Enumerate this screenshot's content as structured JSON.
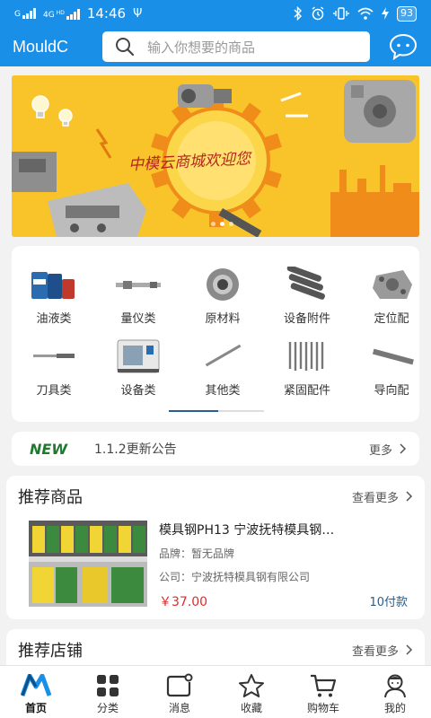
{
  "status_bar": {
    "carrier1": "G",
    "carrier2": "4G",
    "carrier2_sup": "HD",
    "time": "14:46",
    "usb": "Ψ",
    "battery": "93"
  },
  "header": {
    "logo": "MouldC",
    "search_placeholder": "输入你想要的商品",
    "accent_color": "#1a8fe8"
  },
  "banner": {
    "title": "中模云商城欢迎您",
    "dots": 3,
    "active_dot": 1
  },
  "categories": [
    {
      "label": "油液类",
      "icon": "oil-barrels-icon"
    },
    {
      "label": "量仪类",
      "icon": "gauge-instrument-icon"
    },
    {
      "label": "原材料",
      "icon": "raw-material-icon"
    },
    {
      "label": "设备附件",
      "icon": "equipment-accessory-icon"
    },
    {
      "label": "定位配",
      "icon": "positioning-part-icon"
    },
    {
      "label": "刀具类",
      "icon": "cutting-tool-icon"
    },
    {
      "label": "设备类",
      "icon": "machine-equipment-icon"
    },
    {
      "label": "其他类",
      "icon": "other-category-icon"
    },
    {
      "label": "紧固配件",
      "icon": "fastener-icon"
    },
    {
      "label": "导向配",
      "icon": "guide-part-icon"
    }
  ],
  "notice": {
    "badge": "NEW",
    "text": "1.1.2更新公告",
    "more": "更多"
  },
  "recommended": {
    "title": "推荐商品",
    "more": "查看更多",
    "product": {
      "name": "模具钢PH13 宁波抚特模具钢…",
      "brand": "品牌：暂无品牌",
      "company": "公司：宁波抚特模具钢有限公司",
      "price": "￥37.00",
      "payments": "10付款"
    }
  },
  "shops": {
    "title": "推荐店铺",
    "more": "查看更多"
  },
  "tabs": [
    {
      "label": "首页",
      "icon": "home-logo-icon",
      "active": true
    },
    {
      "label": "分类",
      "icon": "category-grid-icon",
      "active": false
    },
    {
      "label": "消息",
      "icon": "message-icon",
      "active": false
    },
    {
      "label": "收藏",
      "icon": "star-icon",
      "active": false
    },
    {
      "label": "购物车",
      "icon": "cart-icon",
      "active": false
    },
    {
      "label": "我的",
      "icon": "profile-icon",
      "active": false
    }
  ]
}
